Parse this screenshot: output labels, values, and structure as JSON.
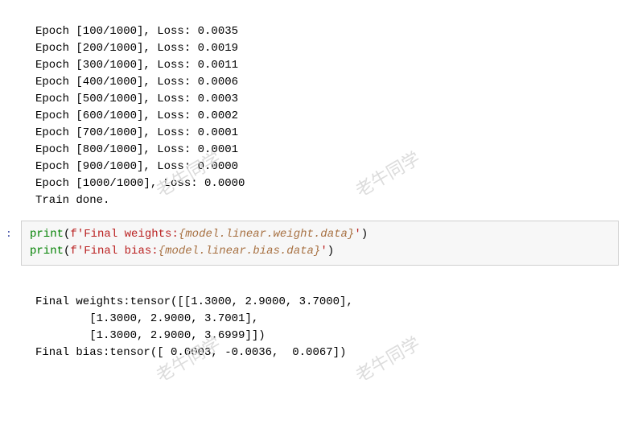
{
  "training_output": [
    "Epoch [100/1000], Loss: 0.0035",
    "Epoch [200/1000], Loss: 0.0019",
    "Epoch [300/1000], Loss: 0.0011",
    "Epoch [400/1000], Loss: 0.0006",
    "Epoch [500/1000], Loss: 0.0003",
    "Epoch [600/1000], Loss: 0.0002",
    "Epoch [700/1000], Loss: 0.0001",
    "Epoch [800/1000], Loss: 0.0001",
    "Epoch [900/1000], Loss: 0.0000",
    "Epoch [1000/1000], Loss: 0.0000",
    "Train done."
  ],
  "code": {
    "prompt": ":",
    "line1": {
      "print": "print",
      "open": "(",
      "fprefix": "f",
      "str_a": "'Final weights:",
      "expr_open": "{",
      "expr": "model.linear.weight.data",
      "expr_close": "}",
      "str_b": "'",
      "close": ")"
    },
    "line2": {
      "print": "print",
      "open": "(",
      "fprefix": "f",
      "str_a": "'Final bias:",
      "expr_open": "{",
      "expr": "model.linear.bias.data",
      "expr_close": "}",
      "str_b": "'",
      "close": ")"
    }
  },
  "final_output": [
    "Final weights:tensor([[1.3000, 2.9000, 3.7000],",
    "        [1.3000, 2.9000, 3.7001],",
    "        [1.3000, 2.9000, 3.6999]])",
    "Final bias:tensor([ 0.0003, -0.0036,  0.0067])"
  ],
  "watermark": "老牛同学"
}
